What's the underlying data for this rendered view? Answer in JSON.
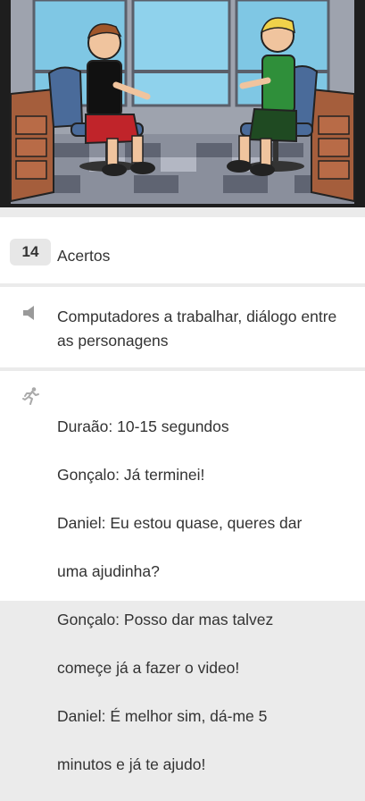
{
  "scene": {
    "image_name": "storyboard-scene-two-characters-in-office-chairs",
    "colors": {
      "frame": "#1e1e1e",
      "window_sky": "#89cce6",
      "floor_dark": "#6b7080",
      "floor_light": "#a4a9b7",
      "chair": "#4a6b9a",
      "shirt_left": "#c0242a",
      "shirt_right": "#2f8f3a",
      "desk": "#a55e3c"
    }
  },
  "count_row": {
    "badge_value": "14",
    "label": "Acertos"
  },
  "sound_row": {
    "icon": "speaker-icon",
    "text": "Computadores a trabalhar, diálogo entre as personagens"
  },
  "action_row": {
    "icon": "running-figure-icon",
    "lines": [
      "Duraão: 10-15 segundos",
      "Gonçalo: Já terminei!",
      "Daniel: Eu estou quase, queres dar",
      "uma ajudinha?",
      "Gonçalo: Posso dar mas talvez",
      "começe já a fazer o video!",
      "Daniel: É melhor sim, dá-me 5",
      "minutos e já te ajudo!"
    ]
  }
}
